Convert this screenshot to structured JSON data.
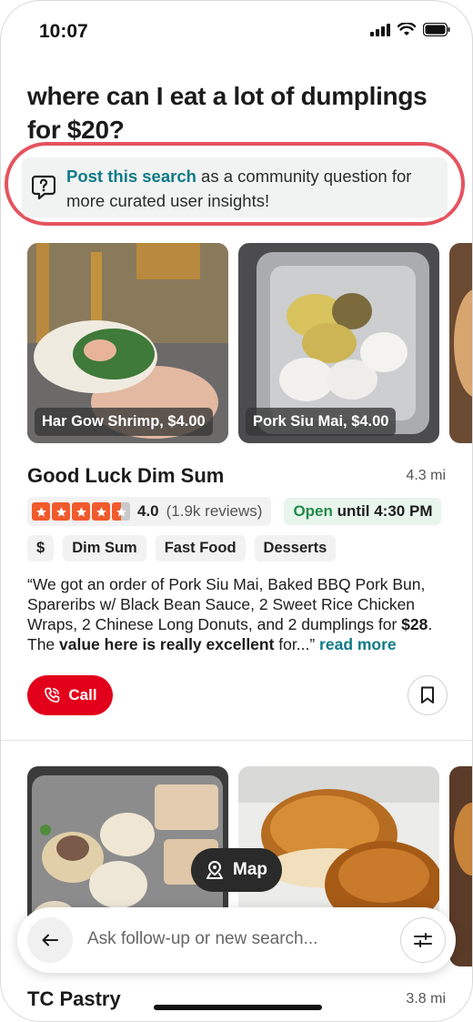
{
  "status_bar": {
    "time": "10:07",
    "icons": [
      "signal-icon",
      "wifi-icon",
      "battery-icon"
    ]
  },
  "query": "where can I eat a lot of dumplings for $20?",
  "callout": {
    "link_text": "Post this search",
    "rest_text": " as a community question for more curated user insights!",
    "icon": "question-bubble-icon"
  },
  "results": [
    {
      "photos": [
        {
          "caption": "Har Gow Shrimp, $4.00"
        },
        {
          "caption": "Pork Siu Mai, $4.00"
        },
        {
          "caption": ""
        }
      ],
      "name": "Good Luck Dim Sum",
      "distance": "4.3 mi",
      "rating": "4.0",
      "rating_value": 4.5,
      "reviews": "(1.9k reviews)",
      "open_label": "Open",
      "open_until": " until 4:30 PM",
      "tags": [
        "$",
        "Dim Sum",
        "Fast Food",
        "Desserts"
      ],
      "review": {
        "p1": "“We got an order of Pork Siu Mai, Baked BBQ Pork Bun, Spareribs w/ Black Bean Sauce, 2 Sweet Rice Chicken Wraps, 2 Chinese Long Donuts, and 2 dumplings for ",
        "b1": "$28",
        "p2": ". The ",
        "b2": "value here is really excellent",
        "p3": " for...” ",
        "more": "read more"
      },
      "call_label": "Call"
    },
    {
      "photos": [
        {
          "caption": ""
        },
        {
          "caption": ""
        },
        {
          "caption": ""
        }
      ],
      "name": "TC Pastry",
      "distance": "3.8 mi"
    }
  ],
  "map_button": "Map",
  "search": {
    "placeholder": "Ask follow-up or new search..."
  },
  "colors": {
    "accent_red": "#e3001b",
    "link_teal": "#0e7a88",
    "highlight_ring": "#e5535f",
    "star_orange": "#f05a2c",
    "open_green": "#238a4a"
  }
}
